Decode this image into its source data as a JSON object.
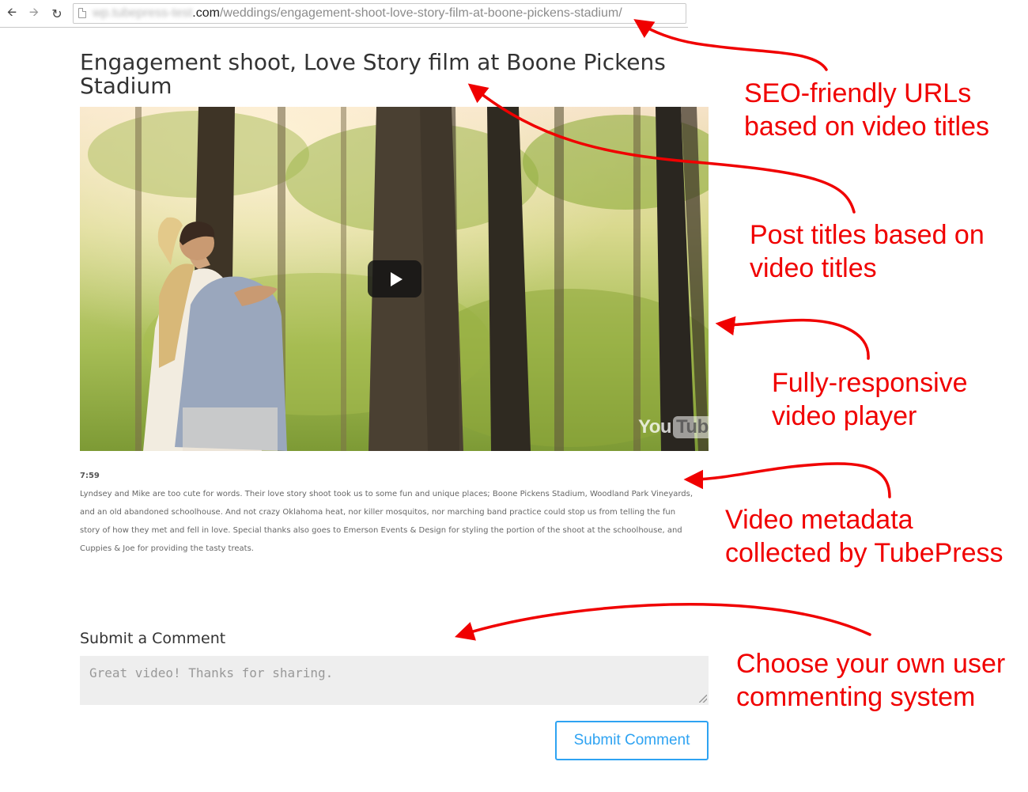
{
  "browser": {
    "back_icon": "arrow-left-icon",
    "forward_icon": "arrow-right-icon",
    "reload_icon": "reload-icon",
    "url_host": "wp.tubepress-test",
    "url_domain": ".com",
    "url_path": "/weddings/engagement-shoot-love-story-film-at-boone-pickens-stadium/"
  },
  "post": {
    "title": "Engagement shoot, Love Story film at Boone Pickens Stadium",
    "video": {
      "play_icon": "play-icon",
      "logo_you": "You",
      "logo_tube": "Tube"
    },
    "duration": "7:59",
    "description": "Lyndsey and Mike are too cute for words. Their love story shoot took us to some fun and unique places; Boone Pickens Stadium, Woodland Park Vineyards, and an old abandoned schoolhouse. And not crazy Oklahoma heat, nor killer mosquitos, nor marching band practice could stop us from telling the fun story of how they met and fell in love. Special thanks also goes to Emerson Events & Design for styling the portion of the shoot at the schoolhouse, and Cuppies & Joe for providing the tasty treats."
  },
  "comments": {
    "heading": "Submit a Comment",
    "placeholder": "Great video! Thanks for sharing.",
    "submit_label": "Submit Comment"
  },
  "annotations": [
    {
      "line1": "SEO-friendly URLs",
      "line2": "based on video titles"
    },
    {
      "line1": "Post titles based on",
      "line2": "video titles"
    },
    {
      "line1": "Fully-responsive",
      "line2": "video player"
    },
    {
      "line1": "Video metadata",
      "line2": "collected by TubePress"
    },
    {
      "line1": "Choose your own user",
      "line2": "commenting system"
    }
  ],
  "colors": {
    "annotation": "#f00000",
    "link_accent": "#2ea3f2"
  }
}
